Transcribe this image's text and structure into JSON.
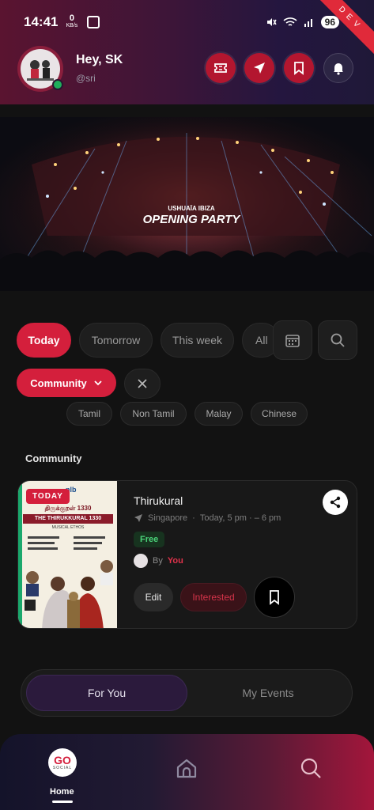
{
  "status_bar": {
    "time": "14:41",
    "net_speed": "0",
    "net_unit": "KB/s",
    "battery": "96",
    "build_tag": "DEV"
  },
  "header": {
    "greeting": "Hey, SK",
    "handle": "@sri"
  },
  "header_icons": [
    "ticket-icon",
    "send-icon",
    "bookmark-icon",
    "bell-icon"
  ],
  "banner": {
    "overlay_line1": "USHUAÏA IBIZA",
    "overlay_line2": "OPENING PARTY"
  },
  "date_filters": {
    "today": "Today",
    "tomorrow": "Tomorrow",
    "this_week": "This week",
    "all": "All"
  },
  "category": {
    "selected": "Community"
  },
  "sub_filters": {
    "tamil": "Tamil",
    "non_tamil": "Non Tamil",
    "malay": "Malay",
    "chinese": "Chinese"
  },
  "section": {
    "title": "Community"
  },
  "event": {
    "badge": "TODAY",
    "title": "Thirukural",
    "location": "Singapore",
    "time": "Today, 5 pm · – 6 pm",
    "price": "Free",
    "by_prefix": "By",
    "by_name": "You",
    "edit_label": "Edit",
    "interested_label": "Interested",
    "poster_title_tamil": "திருக்குறள் 1330",
    "poster_title": "THE THIRUKKURAL 1330",
    "poster_sub": "MUSICAL ETHOS",
    "poster_brand": "nlb"
  },
  "tabs": {
    "for_you": "For You",
    "my_events": "My Events"
  },
  "bottom_nav": {
    "logo": "GO",
    "logo_sub": "SOCIAL",
    "home_label": "Home"
  },
  "colors": {
    "accent": "#d41f3c",
    "free": "#4ad178",
    "background": "#121212"
  }
}
